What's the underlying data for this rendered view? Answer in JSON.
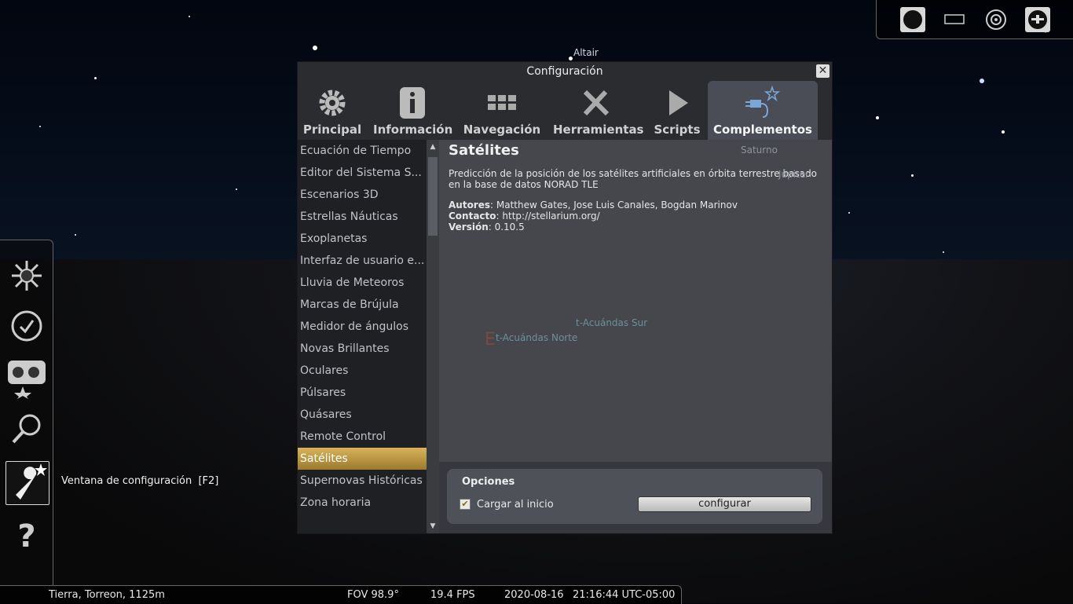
{
  "sky": {
    "labels": [
      "Altair",
      "Júpiter",
      "Saturno",
      "t-Acuándas Sur",
      "t-Acuándas Norte"
    ],
    "cardinal": "E"
  },
  "top_toolbar": {
    "icons": [
      "full-screen-icon",
      "windowed-mode-icon",
      "ocular-icon",
      "satellite-plugin-icon"
    ]
  },
  "left_toolbar": {
    "icons": [
      "location-icon",
      "clock-icon",
      "sky-and-viewing-options-icon",
      "search-icon",
      "configuration-icon",
      "help-icon"
    ],
    "tooltip": "Ventana de configuración  [F2]"
  },
  "bottom_bar": {
    "location": "Tierra, Torreon, 1125m",
    "fov": "FOV 98.9°",
    "fps": "19.4 FPS",
    "date": "2020-08-16",
    "time": "21:16:44 UTC-05:00"
  },
  "dialog": {
    "title": "Configuración",
    "tabs": [
      {
        "label": "Principal"
      },
      {
        "label": "Información"
      },
      {
        "label": "Navegación"
      },
      {
        "label": "Herramientas"
      },
      {
        "label": "Scripts"
      },
      {
        "label": "Complementos"
      }
    ],
    "plugins": [
      "Ecuación de Tiempo",
      "Editor del Sistema S...",
      "Escenarios 3D",
      "Estrellas Náuticas",
      "Exoplanetas",
      "Interfaz de usuario e...",
      "Lluvia de Meteoros",
      "Marcas de Brújula",
      "Medidor de ángulos",
      "Novas Brillantes",
      "Oculares",
      "Púlsares",
      "Quásares",
      "Remote Control",
      "Satélites",
      "Supernovas Históricas",
      "Zona horaria"
    ],
    "selected_plugin": "Satélites",
    "detail": {
      "title": "Satélites",
      "description": "Predicción de la posición de los satélites artificiales en órbita terrestre basado en la base de datos NORAD TLE",
      "authors_label": "Autores",
      "authors": ": Matthew Gates, Jose Luis Canales, Bogdan Marinov",
      "contact_label": "Contacto",
      "contact": ": http://stellarium.org/",
      "version_label": "Versión",
      "version": ": 0.10.5"
    },
    "options": {
      "title": "Opciones",
      "load_at_startup": "Cargar al inicio",
      "load_checked": true,
      "configure_button": "configurar"
    }
  },
  "colors": {
    "accent_selected": "#c9a24a",
    "dialog_bg": "#45474d"
  }
}
